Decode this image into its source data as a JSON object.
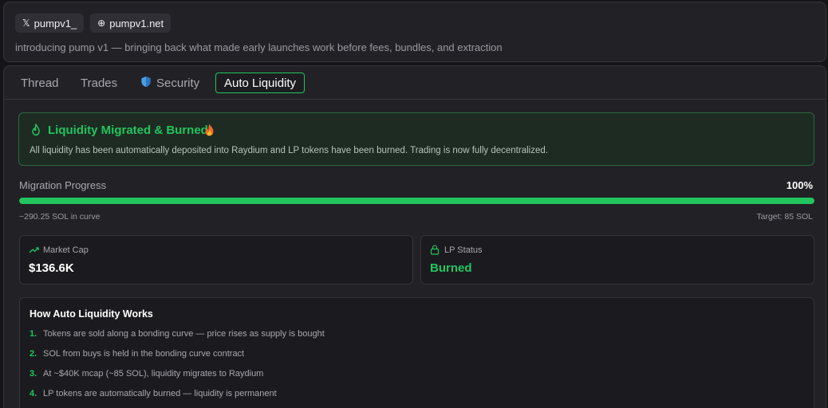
{
  "header": {
    "chips": [
      {
        "icon": "x-logo-icon",
        "glyph": "𝕏",
        "label": "pumpv1_"
      },
      {
        "icon": "globe-icon",
        "glyph": "⊕",
        "label": "pumpv1.net"
      }
    ],
    "tagline": "introducing pump v1 — bringing back what made early launches work before fees, bundles, and extraction"
  },
  "tabs": [
    {
      "label": "Thread",
      "active": false
    },
    {
      "label": "Trades",
      "active": false
    },
    {
      "label": "Security",
      "icon": "shield-icon",
      "active": false
    },
    {
      "label": "Auto Liquidity",
      "active": true
    }
  ],
  "alert": {
    "title": "Liquidity Migrated & Burned",
    "text": "All liquidity has been automatically deposited into Raydium and LP tokens have been burned. Trading is now fully decentralized."
  },
  "progress": {
    "label": "Migration Progress",
    "percent_text": "100%",
    "value": 1.0,
    "curve_text": "~290.25 SOL in curve",
    "target_text": "Target: 85 SOL"
  },
  "stats": [
    {
      "icon": "trending-up-icon",
      "label": "Market Cap",
      "value": "$136.6K"
    },
    {
      "icon": "lock-icon",
      "label": "LP Status",
      "value": "Burned"
    }
  ],
  "how": {
    "title": "How Auto Liquidity Works",
    "steps": [
      {
        "num": "1.",
        "text": "Tokens are sold along a bonding curve — price rises as supply is bought"
      },
      {
        "num": "2.",
        "text": "SOL from buys is held in the bonding curve contract"
      },
      {
        "num": "3.",
        "text": "At ~$40K mcap (~85 SOL), liquidity migrates to Raydium"
      },
      {
        "num": "4.",
        "text": "LP tokens are automatically burned — liquidity is permanent"
      }
    ]
  },
  "colors": {
    "accent": "#22c55e",
    "background": "#151519",
    "card": "#222226"
  }
}
